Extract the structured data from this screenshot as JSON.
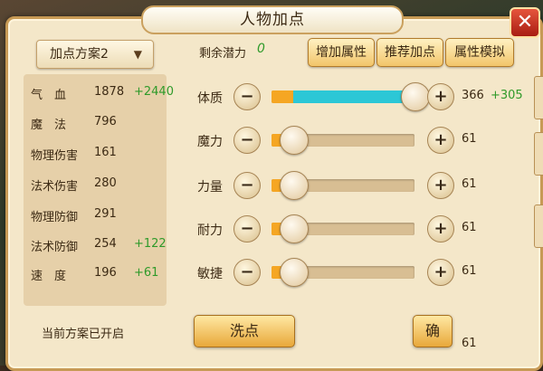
{
  "window": {
    "title": "人物加点",
    "close_label": "✕"
  },
  "scheme": {
    "selected": "加点方案2",
    "status": "当前方案已开启"
  },
  "stats": [
    {
      "name": "气　血",
      "value": "1878",
      "bonus": "+2440"
    },
    {
      "name": "魔　法",
      "value": "796",
      "bonus": ""
    },
    {
      "name": "物理伤害",
      "value": "161",
      "bonus": ""
    },
    {
      "name": "法术伤害",
      "value": "280",
      "bonus": ""
    },
    {
      "name": "物理防御",
      "value": "291",
      "bonus": ""
    },
    {
      "name": "法术防御",
      "value": "254",
      "bonus": "+122"
    },
    {
      "name": "速　度",
      "value": "196",
      "bonus": "+61"
    }
  ],
  "potential": {
    "label": "剩余潜力",
    "value": "0"
  },
  "toolbar": {
    "add_attr": "增加属性",
    "recommend": "推荐加点",
    "simulate": "属性模拟"
  },
  "attributes": [
    {
      "name": "体质",
      "value": "366",
      "bonus": "+305",
      "base_fraction": 0.15,
      "added_fraction": 0.85
    },
    {
      "name": "魔力",
      "value": "61",
      "bonus": "",
      "base_fraction": 0.15,
      "added_fraction": 0
    },
    {
      "name": "力量",
      "value": "61",
      "bonus": "",
      "base_fraction": 0.15,
      "added_fraction": 0
    },
    {
      "name": "耐力",
      "value": "61",
      "bonus": "",
      "base_fraction": 0.15,
      "added_fraction": 0
    },
    {
      "name": "敏捷",
      "value": "61",
      "bonus": "",
      "base_fraction": 0.15,
      "added_fraction": 0
    }
  ],
  "actions": {
    "reset": "洗点",
    "confirm": "确"
  },
  "extra_value": "61",
  "colors": {
    "accent": "#f5a623",
    "added": "#2cc7d6",
    "bonus": "#2f9a2a",
    "close": "#c62a1a"
  }
}
